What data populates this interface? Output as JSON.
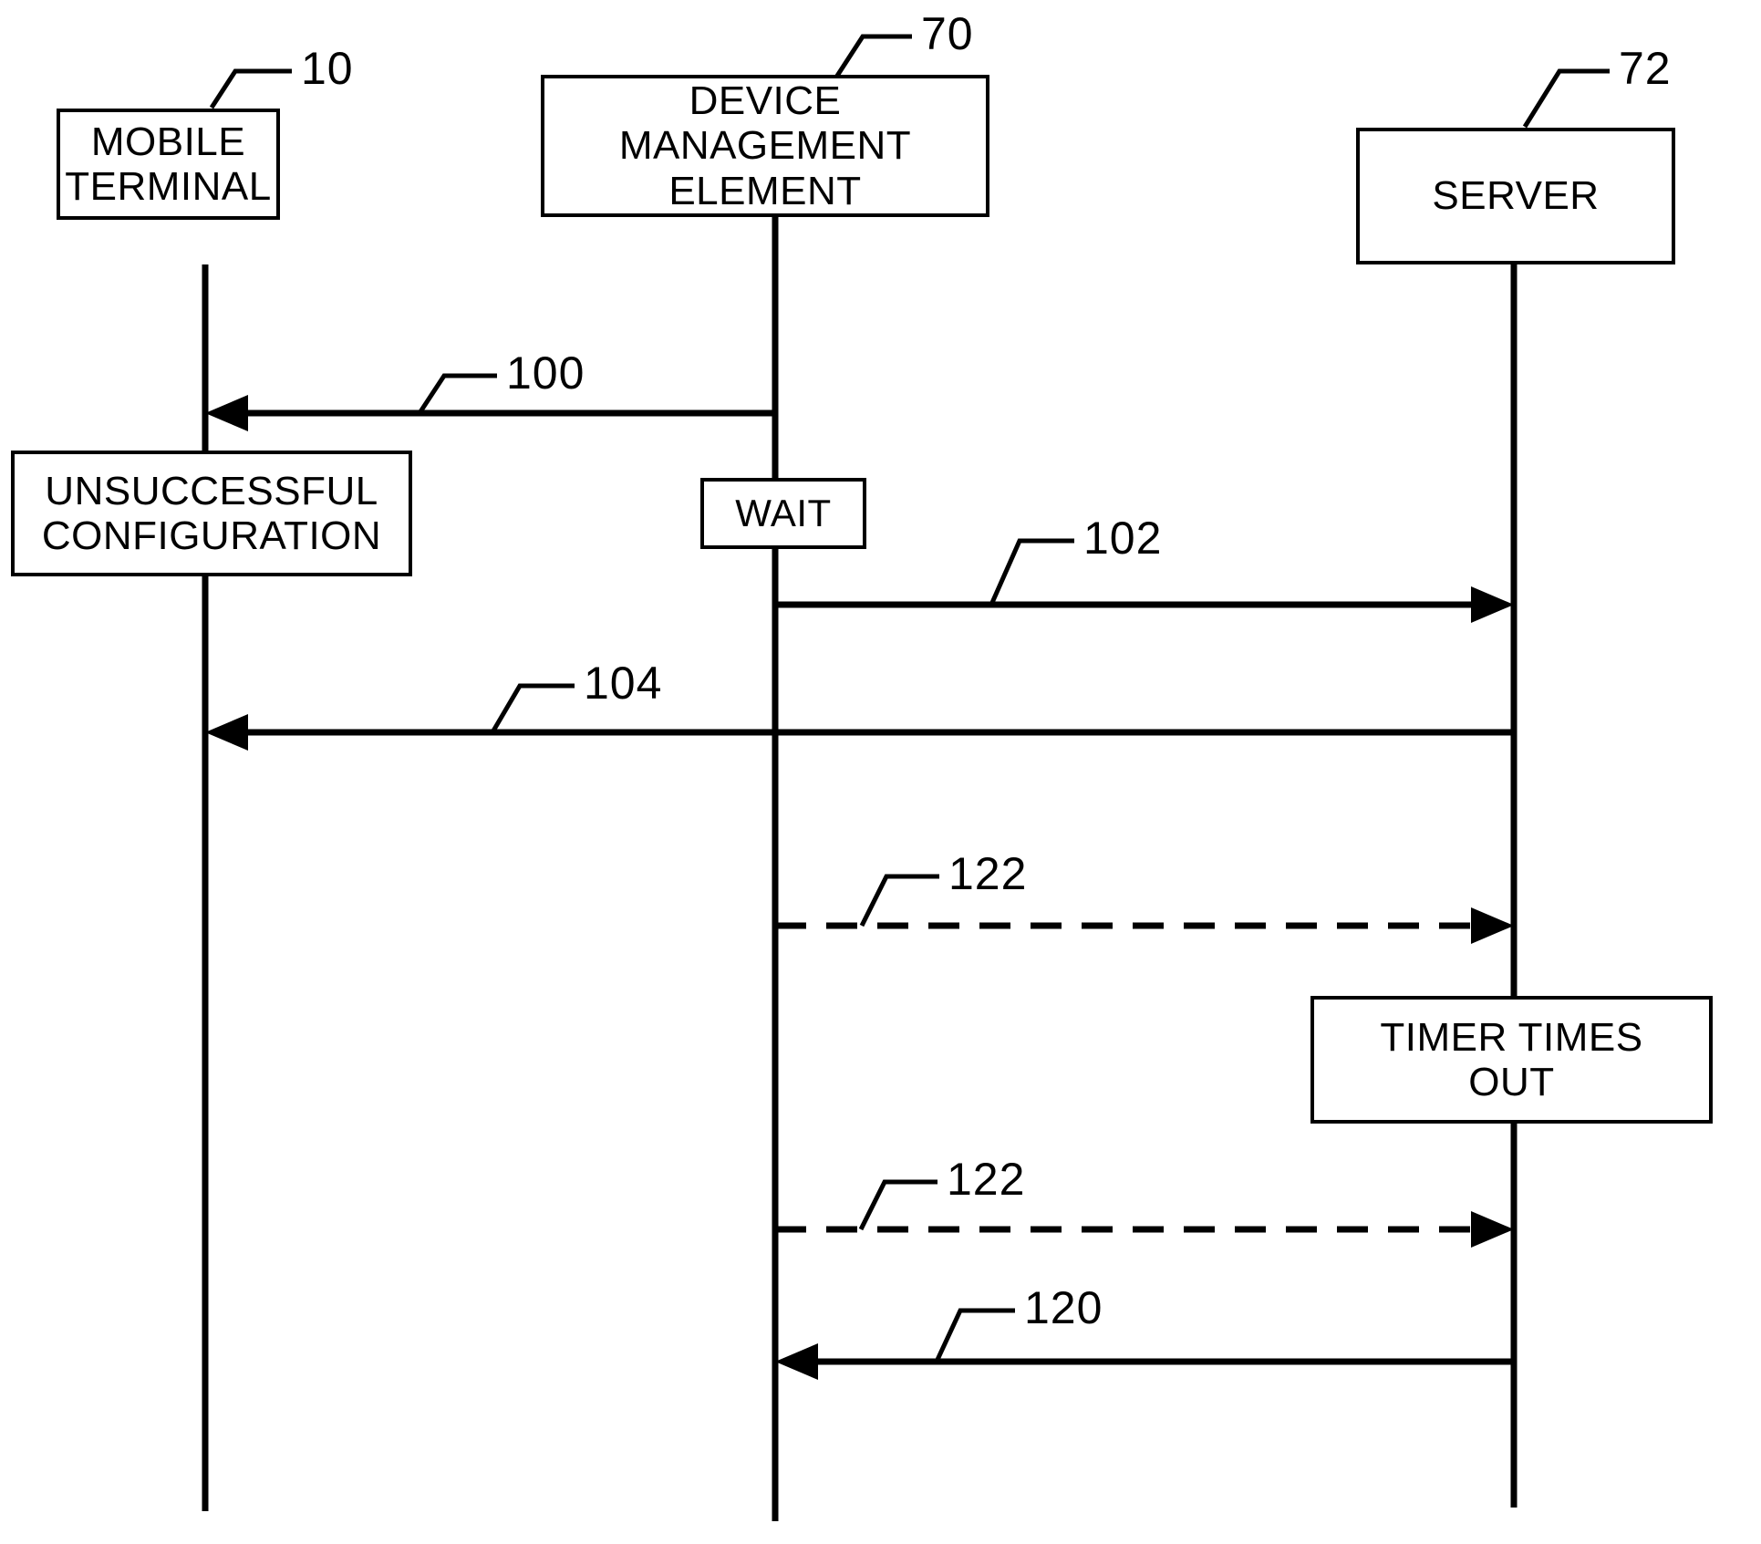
{
  "figure": {
    "type": "sequence-diagram",
    "background_color": "#ffffff",
    "line_color": "#000000"
  },
  "lanes": [
    {
      "id": "mobile-terminal",
      "label": "MOBILE\nTERMINAL",
      "ref": "10"
    },
    {
      "id": "device-management-element",
      "label": "DEVICE\nMANAGEMENT\nELEMENT",
      "ref": "70"
    },
    {
      "id": "server",
      "label": "SERVER",
      "ref": "72"
    }
  ],
  "state_boxes": [
    {
      "id": "unsuccessful-configuration",
      "label": "UNSUCCESSFUL\nCONFIGURATION"
    },
    {
      "id": "wait",
      "label": "WAIT"
    },
    {
      "id": "timer-times-out",
      "label": "TIMER TIMES\nOUT"
    }
  ],
  "messages": [
    {
      "id": "msg-100",
      "ref": "100",
      "from": "device-management-element",
      "to": "mobile-terminal",
      "style": "solid",
      "direction": "left"
    },
    {
      "id": "msg-102",
      "ref": "102",
      "from": "device-management-element",
      "to": "server",
      "style": "solid",
      "direction": "right"
    },
    {
      "id": "msg-104",
      "ref": "104",
      "from": "server",
      "to": "mobile-terminal",
      "style": "solid",
      "direction": "left"
    },
    {
      "id": "msg-122-a",
      "ref": "122",
      "from": "device-management-element",
      "to": "server",
      "style": "dashed",
      "direction": "right"
    },
    {
      "id": "msg-122-b",
      "ref": "122",
      "from": "device-management-element",
      "to": "server",
      "style": "dashed",
      "direction": "right"
    },
    {
      "id": "msg-120",
      "ref": "120",
      "from": "server",
      "to": "device-management-element",
      "style": "solid",
      "direction": "left"
    }
  ],
  "ref_labels": {
    "lane_mt": "10",
    "lane_dme": "70",
    "lane_server": "72",
    "m100": "100",
    "m102": "102",
    "m104": "104",
    "m122a": "122",
    "m122b": "122",
    "m120": "120"
  },
  "box_text": {
    "mobile_terminal_l1": "MOBILE",
    "mobile_terminal_l2": "TERMINAL",
    "dme_l1": "DEVICE",
    "dme_l2": "MANAGEMENT",
    "dme_l3": "ELEMENT",
    "server": "SERVER",
    "unsuccessful_l1": "UNSUCCESSFUL",
    "unsuccessful_l2": "CONFIGURATION",
    "wait": "WAIT",
    "timer_l1": "TIMER TIMES",
    "timer_l2": "OUT"
  }
}
